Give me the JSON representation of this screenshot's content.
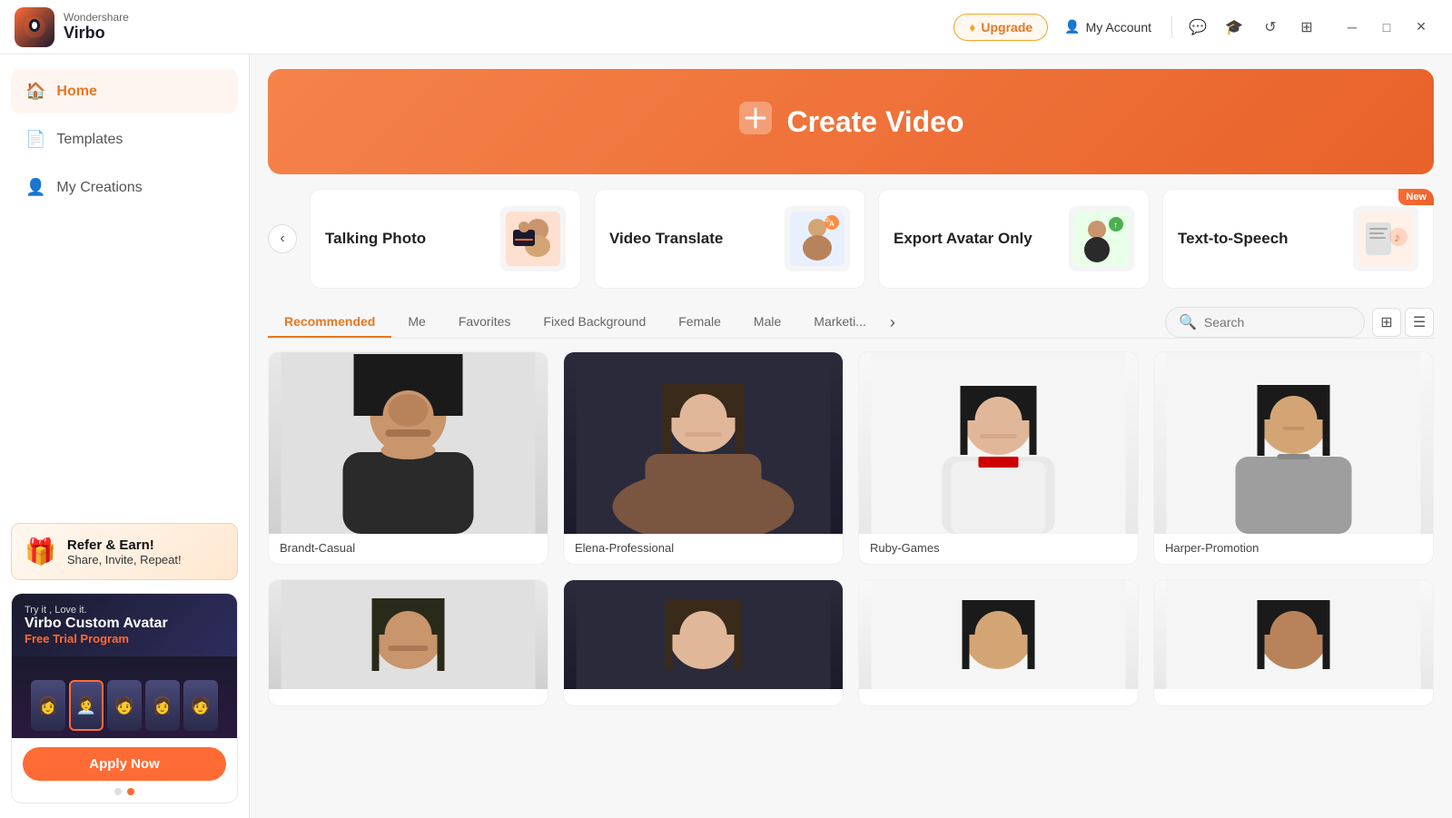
{
  "app": {
    "brand": "Wondershare",
    "name": "Virbo"
  },
  "titlebar": {
    "upgrade_label": "Upgrade",
    "account_label": "My Account",
    "icons": [
      "chat",
      "education",
      "history",
      "grid"
    ],
    "window_controls": [
      "minimize",
      "maximize",
      "close"
    ]
  },
  "sidebar": {
    "items": [
      {
        "id": "home",
        "label": "Home",
        "icon": "🏠",
        "active": true
      },
      {
        "id": "templates",
        "label": "Templates",
        "icon": "📄",
        "active": false
      },
      {
        "id": "my-creations",
        "label": "My Creations",
        "icon": "👤",
        "active": false
      }
    ],
    "promo_refer": {
      "title": "Refer & Earn!",
      "subtitle": "Share, Invite, Repeat!"
    },
    "promo_avatar": {
      "try_label": "Try it , Love it.",
      "title": "Virbo Custom Avatar",
      "free_trial": "Free Trial Program",
      "apply_label": "Apply Now"
    }
  },
  "banner": {
    "title": "Create Video"
  },
  "feature_cards": [
    {
      "id": "talking-photo",
      "title": "Talking Photo",
      "icon": "📸",
      "badge": null
    },
    {
      "id": "video-translate",
      "title": "Video Translate",
      "icon": "🎬",
      "badge": null
    },
    {
      "id": "export-avatar",
      "title": "Export Avatar Only",
      "icon": "👤",
      "badge": null
    },
    {
      "id": "text-to-speech",
      "title": "Text-to-Speech",
      "icon": "🔊",
      "badge": "New"
    }
  ],
  "tabs": {
    "items": [
      {
        "id": "recommended",
        "label": "Recommended",
        "active": true
      },
      {
        "id": "me",
        "label": "Me",
        "active": false
      },
      {
        "id": "favorites",
        "label": "Favorites",
        "active": false
      },
      {
        "id": "fixed-background",
        "label": "Fixed Background",
        "active": false
      },
      {
        "id": "female",
        "label": "Female",
        "active": false
      },
      {
        "id": "male",
        "label": "Male",
        "active": false
      },
      {
        "id": "marketing",
        "label": "Marketi...",
        "active": false
      }
    ],
    "search_placeholder": "Search"
  },
  "avatars": [
    {
      "id": "brandt",
      "name": "Brandt-Casual",
      "skin": "skin-1",
      "outfit": "outfit-dark",
      "bg": "bg-gray",
      "hair": "dark-short"
    },
    {
      "id": "elena",
      "name": "Elena-Professional",
      "skin": "skin-2",
      "outfit": "outfit-brown",
      "bg": "bg-dark",
      "hair": "light-long"
    },
    {
      "id": "ruby",
      "name": "Ruby-Games",
      "skin": "skin-2",
      "outfit": "outfit-white",
      "bg": "bg-white",
      "hair": "dark-long"
    },
    {
      "id": "harper",
      "name": "Harper-Promotion",
      "skin": "skin-3",
      "outfit": "outfit-gray",
      "bg": "bg-white",
      "hair": "dark-long"
    },
    {
      "id": "avatar5",
      "name": "",
      "skin": "skin-1",
      "outfit": "outfit-dark",
      "bg": "bg-gray",
      "hair": "dark-beard"
    },
    {
      "id": "avatar6",
      "name": "",
      "skin": "skin-2",
      "outfit": "outfit-brown",
      "bg": "bg-dark",
      "hair": "dark-long"
    },
    {
      "id": "avatar7",
      "name": "",
      "skin": "skin-3",
      "outfit": "outfit-white",
      "bg": "bg-white",
      "hair": "dark-long"
    },
    {
      "id": "avatar8",
      "name": "",
      "skin": "skin-4",
      "outfit": "outfit-gray",
      "bg": "bg-white",
      "hair": "dark-long"
    }
  ]
}
